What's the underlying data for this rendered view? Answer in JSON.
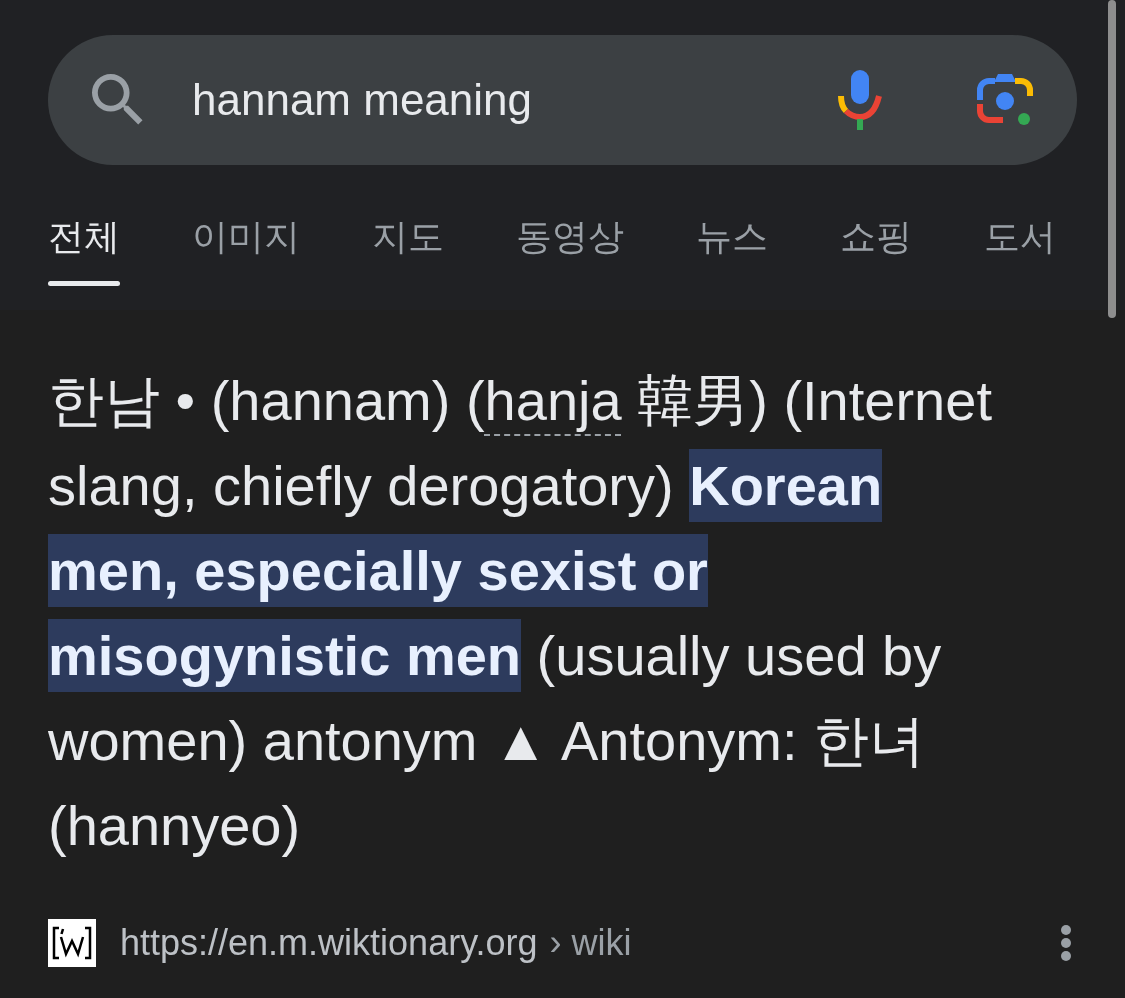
{
  "search": {
    "query": "hannam meaning"
  },
  "tabs": [
    {
      "label": "전체",
      "selected": true
    },
    {
      "label": "이미지",
      "selected": false
    },
    {
      "label": "지도",
      "selected": false
    },
    {
      "label": "동영상",
      "selected": false
    },
    {
      "label": "뉴스",
      "selected": false
    },
    {
      "label": "쇼핑",
      "selected": false
    },
    {
      "label": "도서",
      "selected": false
    }
  ],
  "result": {
    "definition": {
      "before": "한남 • (hannam) (",
      "abbr": "hanja",
      "after": " 韓男) (Internet slang, chiefly derogatory) **Korean men, especially sexist or misogynistic men** (usually used by women) antonym ▲ Antonym: 한녀 (hannyeo)"
    },
    "source": {
      "url": "https://en.m.wiktionary.org",
      "path": "› wiki"
    }
  }
}
